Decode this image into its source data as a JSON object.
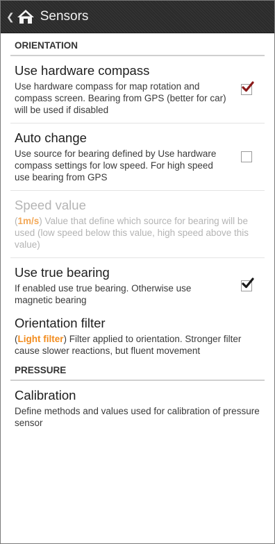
{
  "actionbar": {
    "title": "Sensors",
    "up_icon": "chevron-left-icon",
    "home_icon": "home-icon"
  },
  "sections": [
    {
      "header": "ORIENTATION",
      "items": [
        {
          "title": "Use hardware compass",
          "summary": "Use hardware compass for map rotation and compass screen. Bearing from GPS (better for car) will be used if disabled",
          "checked": true
        },
        {
          "title": "Auto change",
          "summary": "Use source for bearing defined by Use hardware compass settings for low speed. For high speed use bearing from GPS",
          "checked": false
        },
        {
          "title": "Speed value",
          "value": "1m/s",
          "summary": ") Value that define which source for bearing will be used (low speed below this value, high speed above this value)",
          "enabled": false
        },
        {
          "title": "Use true bearing",
          "summary": "If enabled use true bearing. Otherwise use magnetic bearing",
          "checked": true
        },
        {
          "title": "Orientation filter",
          "value": "Light filter",
          "summary": ") Filter applied to orientation. Stronger filter cause slower reactions, but fluent movement"
        }
      ]
    },
    {
      "header": "PRESSURE",
      "items": [
        {
          "title": "Calibration",
          "summary": "Define methods and values used for calibration of pressure sensor"
        }
      ]
    }
  ],
  "colors": {
    "accent": "#f28c1e",
    "checkmark": "#8b1a1a",
    "checkmark_dark": "#1a1a1a",
    "actionbar": "#2b2b2b"
  }
}
